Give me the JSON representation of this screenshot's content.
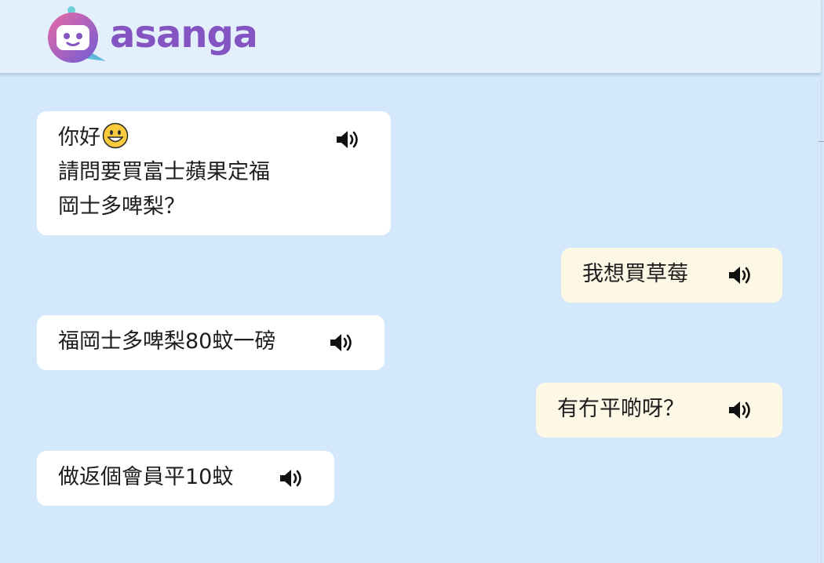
{
  "app": {
    "brand_name": "asanga",
    "colors": {
      "background": "#d4e8fb",
      "header": "#e3f0fc",
      "bot_bubble": "#ffffff",
      "user_bubble": "#fdf8e6",
      "logo_gradient_start": "#e96aa4",
      "logo_gradient_end": "#6f5bd6",
      "logo_text": "#8455c2"
    }
  },
  "messages": [
    {
      "sender": "bot",
      "lines": [
        "你好",
        "請問要買富士蘋果定福",
        "岡士多啤梨？"
      ],
      "emoji": "grinning-face-emoji",
      "audio_icon": "speaker-icon"
    },
    {
      "sender": "user",
      "lines": [
        "我想買草莓"
      ],
      "audio_icon": "speaker-icon"
    },
    {
      "sender": "bot",
      "lines": [
        "福岡士多啤梨80蚊一磅"
      ],
      "audio_icon": "speaker-icon"
    },
    {
      "sender": "user",
      "lines": [
        "有冇平啲呀？"
      ],
      "audio_icon": "speaker-icon"
    },
    {
      "sender": "bot",
      "lines": [
        "做返個會員平10蚊"
      ],
      "audio_icon": "speaker-icon"
    }
  ]
}
